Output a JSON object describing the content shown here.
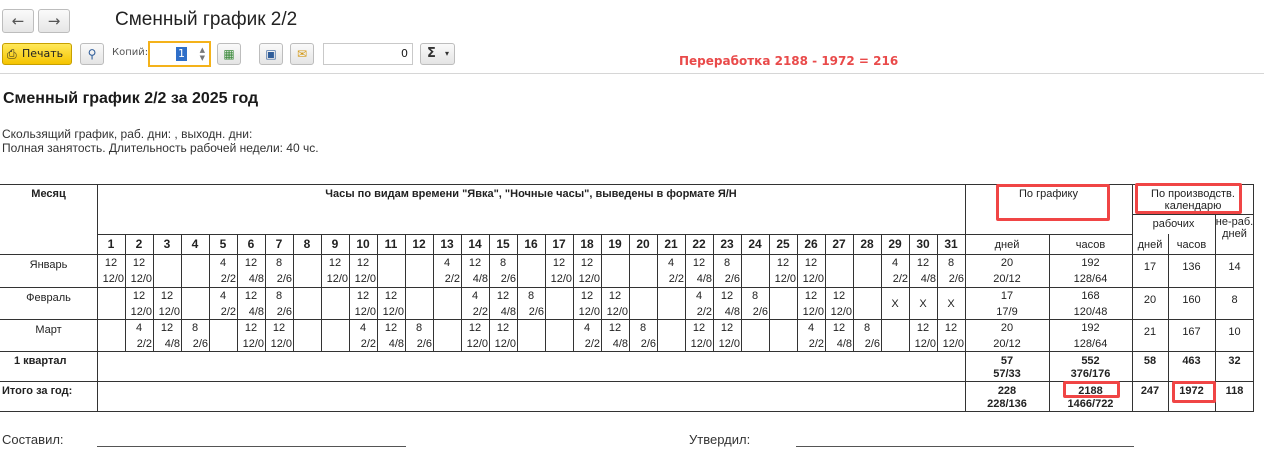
{
  "window": {
    "title": "Сменный график 2/2"
  },
  "toolbar": {
    "print_label": "Печать",
    "copies_label": "Копий:",
    "copies_value": "1",
    "zero_value": "0",
    "sum_label": "Σ"
  },
  "annotation": "Переработка 2188 - 1972 = 216",
  "report": {
    "title": "Сменный график 2/2 за 2025 год",
    "desc1": "Скользящий график, раб. дни: , выходн. дни:",
    "desc2": "Полная занятость. Длительность рабочей недели: 40 чс."
  },
  "table": {
    "month_header": "Месяц",
    "hours_header": "Часы по видам времени \"Явка\", \"Ночные часы\", выведены в формате Я/Н",
    "schedule_header": "По графику",
    "calendar_header": "По производств. календарю",
    "working_label": "рабочих",
    "days_label": "дней",
    "hours_label": "часов",
    "days_label2": "дней",
    "hours_label2": "часов",
    "nonworking_label": "не-раб. дней",
    "day_numbers": [
      "1",
      "2",
      "3",
      "4",
      "5",
      "6",
      "7",
      "8",
      "9",
      "10",
      "11",
      "12",
      "13",
      "14",
      "15",
      "16",
      "17",
      "18",
      "19",
      "20",
      "21",
      "22",
      "23",
      "24",
      "25",
      "26",
      "27",
      "28",
      "29",
      "30",
      "31"
    ],
    "rows": [
      {
        "month": "Январь",
        "days_top": [
          "12",
          "12",
          "",
          "",
          "4",
          "12",
          "8",
          "",
          "12",
          "12",
          "",
          "",
          "4",
          "12",
          "8",
          "",
          "12",
          "12",
          "",
          "",
          "4",
          "12",
          "8",
          "",
          "12",
          "12",
          "",
          "",
          "4",
          "12",
          "8"
        ],
        "days_bottom": [
          "12/0",
          "12/0",
          "",
          "",
          "2/2",
          "4/8",
          "2/6",
          "",
          "12/0",
          "12/0",
          "",
          "",
          "2/2",
          "4/8",
          "2/6",
          "",
          "12/0",
          "12/0",
          "",
          "",
          "2/2",
          "4/8",
          "2/6",
          "",
          "12/0",
          "12/0",
          "",
          "",
          "2/2",
          "4/8",
          "2/6"
        ],
        "sched_days": "20",
        "sched_days_sub": "20/12",
        "sched_hours": "192",
        "sched_hours_sub": "128/64",
        "cal_days": "17",
        "cal_hours": "136",
        "cal_off": "14"
      },
      {
        "month": "Февраль",
        "days_top": [
          "",
          "12",
          "12",
          "",
          "4",
          "12",
          "8",
          "",
          "",
          "12",
          "12",
          "",
          "",
          "4",
          "12",
          "8",
          "",
          "12",
          "12",
          "",
          "",
          "4",
          "12",
          "8",
          "",
          "12",
          "12",
          "",
          "X",
          "X",
          "X"
        ],
        "days_bottom": [
          "",
          "12/0",
          "12/0",
          "",
          "2/2",
          "4/8",
          "2/6",
          "",
          "",
          "12/0",
          "12/0",
          "",
          "",
          "2/2",
          "4/8",
          "2/6",
          "",
          "12/0",
          "12/0",
          "",
          "",
          "2/2",
          "4/8",
          "2/6",
          "",
          "12/0",
          "12/0",
          "",
          "",
          "",
          ""
        ],
        "sched_days": "17",
        "sched_days_sub": "17/9",
        "sched_hours": "168",
        "sched_hours_sub": "120/48",
        "cal_days": "20",
        "cal_hours": "160",
        "cal_off": "8"
      },
      {
        "month": "Март",
        "days_top": [
          "",
          "4",
          "12",
          "8",
          "",
          "12",
          "12",
          "",
          "",
          "4",
          "12",
          "8",
          "",
          "12",
          "12",
          "",
          "",
          "4",
          "12",
          "8",
          "",
          "12",
          "12",
          "",
          "",
          "4",
          "12",
          "8",
          "",
          "12",
          "12"
        ],
        "days_bottom": [
          "",
          "2/2",
          "4/8",
          "2/6",
          "",
          "12/0",
          "12/0",
          "",
          "",
          "2/2",
          "4/8",
          "2/6",
          "",
          "12/0",
          "12/0",
          "",
          "",
          "2/2",
          "4/8",
          "2/6",
          "",
          "12/0",
          "12/0",
          "",
          "",
          "2/2",
          "4/8",
          "2/6",
          "",
          "12/0",
          "12/0"
        ],
        "sched_days": "20",
        "sched_days_sub": "20/12",
        "sched_hours": "192",
        "sched_hours_sub": "128/64",
        "cal_days": "21",
        "cal_hours": "167",
        "cal_off": "10"
      }
    ],
    "quarter": {
      "label": "1 квартал",
      "sched_days": "57",
      "sched_days_sub": "57/33",
      "sched_hours": "552",
      "sched_hours_sub": "376/176",
      "cal_days": "58",
      "cal_hours": "463",
      "cal_off": "32"
    },
    "total": {
      "label": "Итого за год:",
      "sched_days": "228",
      "sched_days_sub": "228/136",
      "sched_hours": "2188",
      "sched_hours_sub": "1466/722",
      "cal_days": "247",
      "cal_hours": "1972",
      "cal_off": "118"
    }
  },
  "footer": {
    "composed": "Составил:",
    "approved": "Утвердил:"
  },
  "colors": {
    "accent_red": "#e94a4a",
    "print_yellow": "#f5c400"
  }
}
